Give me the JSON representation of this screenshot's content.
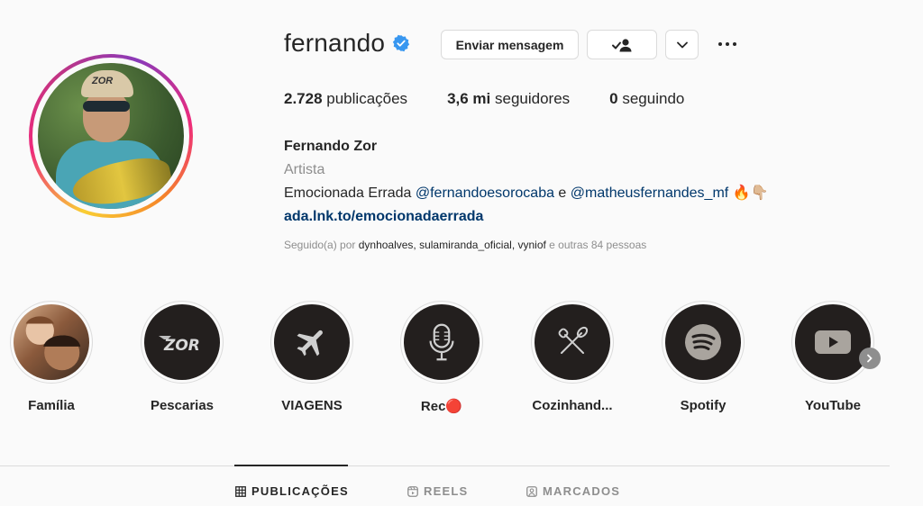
{
  "profile": {
    "username": "fernando",
    "verified": true,
    "buttons": {
      "message": "Enviar mensagem",
      "following_icon": "person-check-icon",
      "more_icon": "chevron-down-icon",
      "options_icon": "more-dots-icon"
    },
    "stats": {
      "posts_value": "2.728",
      "posts_label": " publicações",
      "followers_value": "3,6 mi",
      "followers_label": " seguidores",
      "following_value": "0",
      "following_label": " seguindo"
    },
    "bio": {
      "full_name": "Fernando Zor",
      "category": "Artista",
      "text_prefix": "Emocionada Errada ",
      "mention1": "@fernandoesorocaba",
      "text_mid": " e ",
      "mention2": "@matheusfernandes_mf",
      "emoji": " 🔥👇🏼",
      "link": "ada.lnk.to/emocionadaerrada"
    },
    "followed_by": {
      "prefix": "Seguido(a) por ",
      "users": "dynhoalves, sulamiranda_oficial, vyniof",
      "suffix": " e outras 84 pessoas"
    },
    "avatar_cap_text": "ZOR"
  },
  "highlights": [
    {
      "label": "Família",
      "icon": "photo"
    },
    {
      "label": "Pescarias",
      "icon": "zor-logo-icon",
      "logo_text": "ZOR"
    },
    {
      "label": "VIAGENS",
      "icon": "airplane-icon"
    },
    {
      "label": "Rec🔴",
      "icon": "microphone-icon"
    },
    {
      "label": "Cozinhand...",
      "icon": "kitchen-utensils-icon"
    },
    {
      "label": "Spotify",
      "icon": "spotify-icon"
    },
    {
      "label": "YouTube",
      "icon": "youtube-icon"
    }
  ],
  "tabs": [
    {
      "label": "PUBLICAÇÕES",
      "icon": "grid-icon",
      "active": true
    },
    {
      "label": "REELS",
      "icon": "reels-icon",
      "active": false
    },
    {
      "label": "MARCADOS",
      "icon": "tagged-icon",
      "active": false
    }
  ],
  "colors": {
    "verified_blue": "#3897f0",
    "link_blue": "#00376b",
    "secondary_gray": "#8e8e8e",
    "highlight_bg": "#231f1e"
  }
}
